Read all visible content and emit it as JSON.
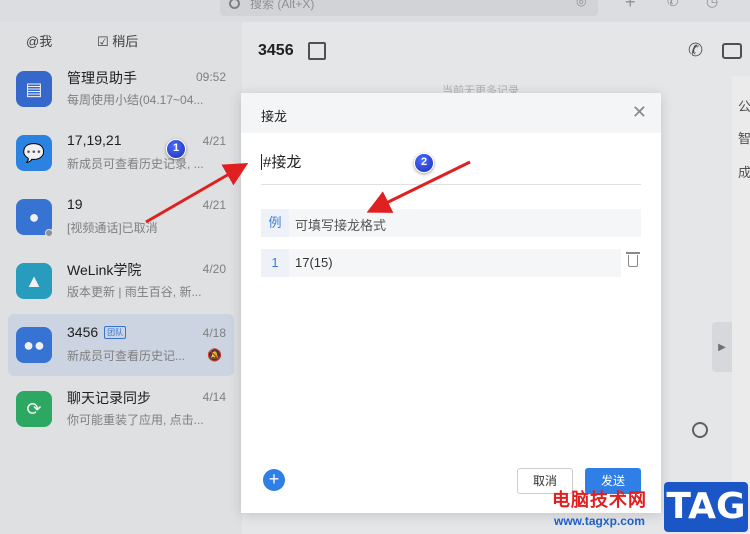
{
  "topbar": {
    "search_placeholder": "搜索 (Alt+X)"
  },
  "filters": {
    "mention": "@我",
    "later": "稍后"
  },
  "conversations": [
    {
      "name": "管理员助手",
      "time": "09:52",
      "preview": "每周使用小结(04.17~04...",
      "avatar_color": "#3a6fd8",
      "icon": "admin-helper-icon"
    },
    {
      "name": "17,19,21",
      "time": "4/21",
      "preview": "新成员可查看历史记录, ...",
      "avatar_color": "#2e8cf0",
      "icon": "chat-bubble-icon"
    },
    {
      "name": "19",
      "time": "4/21",
      "preview": "[视频通话]已取消",
      "avatar_color": "#3a7be0",
      "icon": "person-icon"
    },
    {
      "name": "WeLink学院",
      "time": "4/20",
      "preview": "版本更新 | 雨生百谷, 新...",
      "avatar_color": "#2aa6c8",
      "icon": "graduation-cap-icon"
    },
    {
      "name": "3456",
      "badge": "团队",
      "time": "4/18",
      "preview": "新成员可查看历史记...",
      "avatar_color": "#3a7be0",
      "icon": "group-icon"
    },
    {
      "name": "聊天记录同步",
      "time": "4/14",
      "preview": "你可能重装了应用, 点击...",
      "avatar_color": "#2fb36a",
      "icon": "sync-icon"
    }
  ],
  "chat": {
    "title": "3456",
    "history_hint": "当前无更多记录"
  },
  "side_panel": [
    "公",
    "智",
    "成"
  ],
  "dialog": {
    "title": "接龙",
    "topic": "#接龙",
    "example_index": "例",
    "example_text": "可填写接龙格式",
    "entry_index": "1",
    "entry_text": "17(15)",
    "cancel_label": "取消",
    "send_label": "发送"
  },
  "callouts": [
    "1",
    "2"
  ],
  "watermark": {
    "site_cn": "电脑技术网",
    "url": "www.tagxp.com",
    "tag": "TAG"
  },
  "colors": {
    "accent": "#2f7fe6",
    "arrow": "#e02020"
  }
}
